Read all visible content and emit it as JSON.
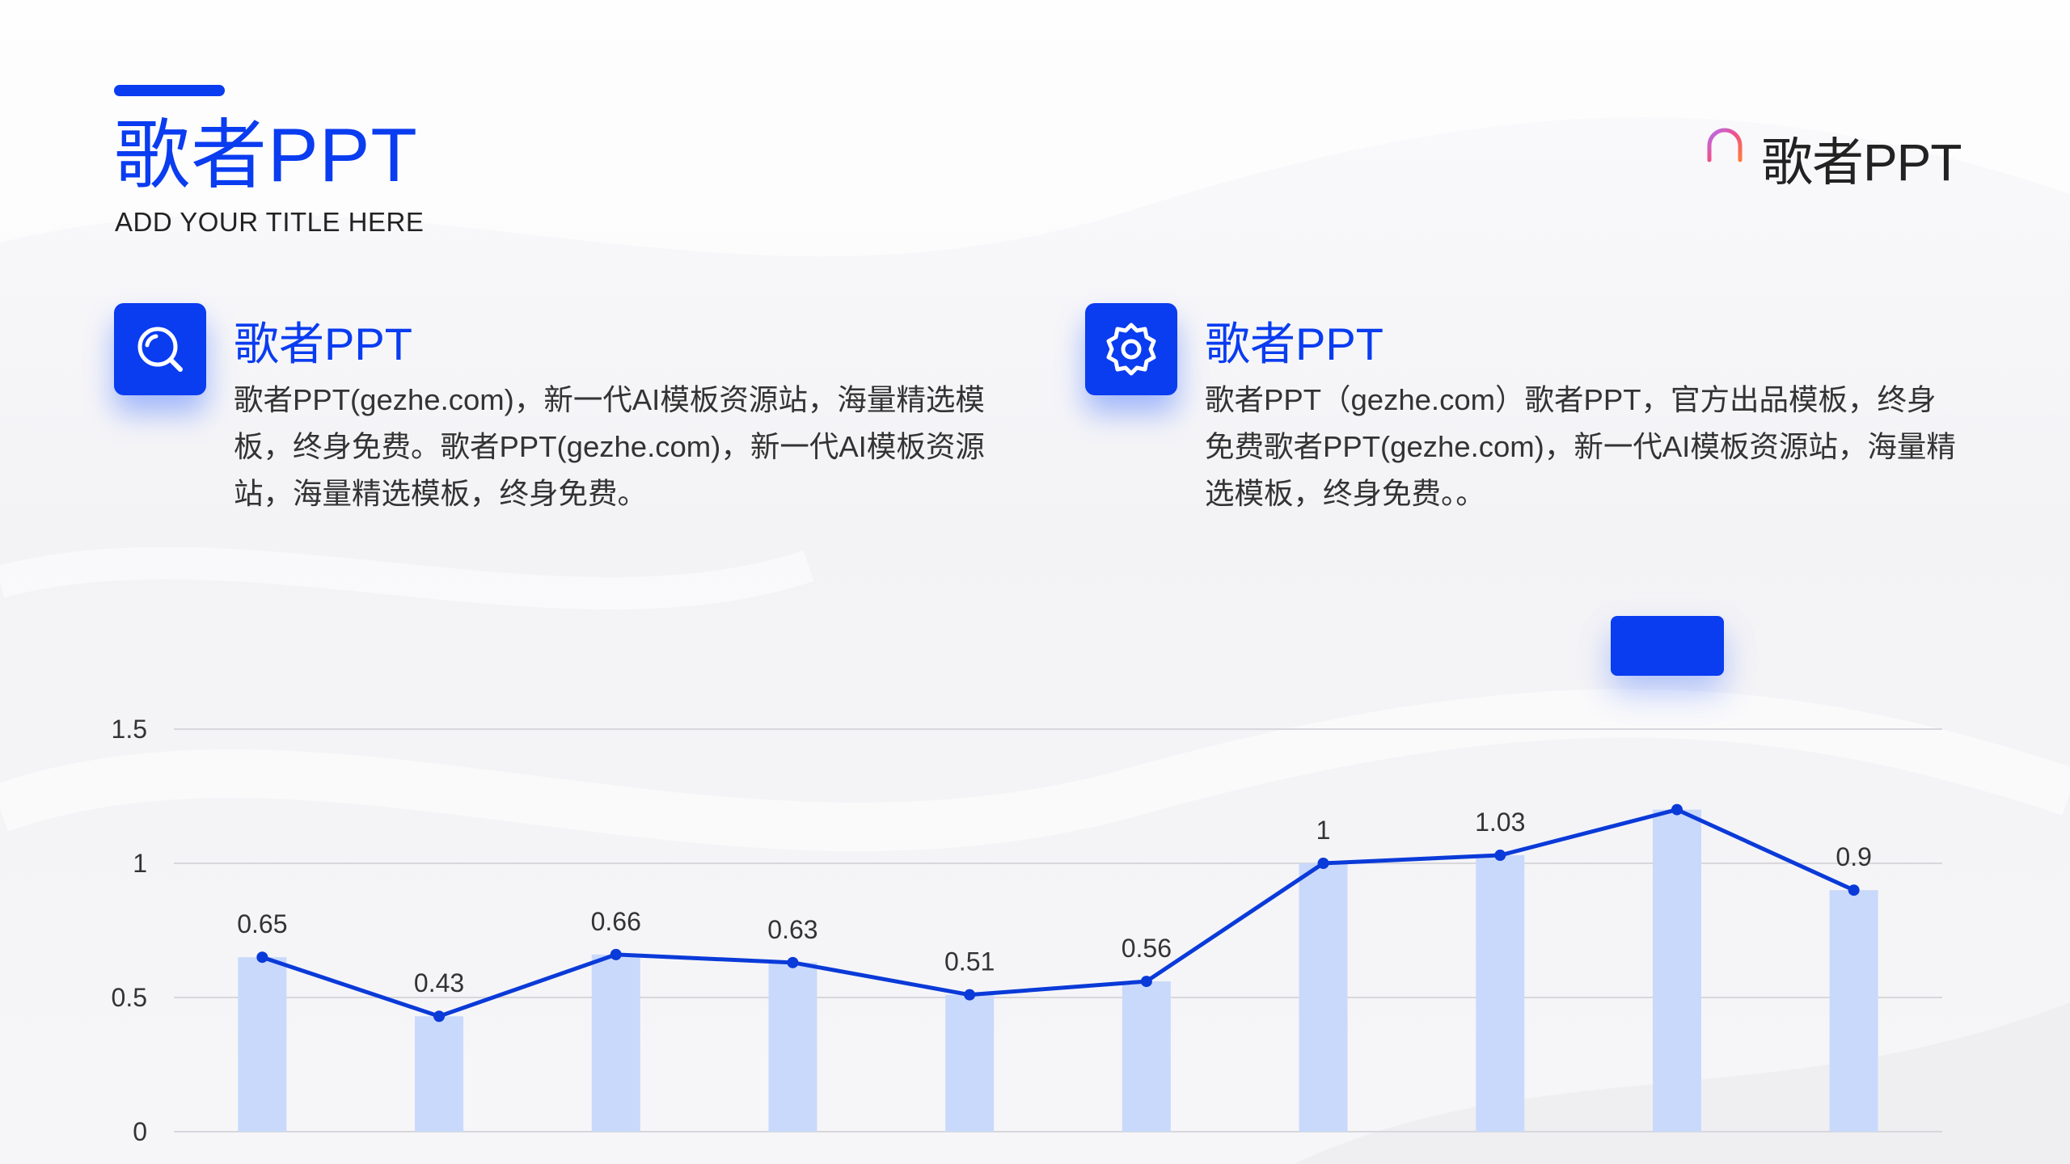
{
  "colors": {
    "accent": "#0a3cf0",
    "bar": "#c9d9fc",
    "line": "#0a3ad8",
    "gridline": "#d7d7dc",
    "tick_text": "#333333",
    "label_text": "#333333"
  },
  "header": {
    "title": "歌者PPT",
    "subtitle": "ADD YOUR TITLE HERE"
  },
  "brand": {
    "name": "歌者PPT",
    "icon": "microphone-wave-logo"
  },
  "cards": [
    {
      "icon": "search-icon",
      "title": "歌者PPT",
      "text": "歌者PPT(gezhe.com)，新一代AI模板资源站，海量精选模板，终身免费。歌者PPT(gezhe.com)，新一代AI模板资源站，海量精选模板，终身免费。"
    },
    {
      "icon": "gear-icon",
      "title": "歌者PPT",
      "text": "歌者PPT（gezhe.com）歌者PPT，官方出品模板，终身免费歌者PPT(gezhe.com)，新一代AI模板资源站，海量精选模板，终身免费。。"
    }
  ],
  "chart_data": {
    "type": "bar",
    "title": "",
    "xlabel": "",
    "ylabel": "",
    "ylim": [
      0,
      1.5
    ],
    "yticks": [
      "0",
      "0.5",
      "1",
      "1.5"
    ],
    "grid": true,
    "categories": [
      "",
      "",
      "",
      "",
      "",
      "",
      "",
      "",
      "",
      ""
    ],
    "series": [
      {
        "type": "bar",
        "values": [
          0.65,
          0.43,
          0.66,
          0.63,
          0.51,
          0.56,
          1.0,
          1.03,
          1.2,
          0.9
        ]
      },
      {
        "type": "line",
        "values": [
          0.65,
          0.43,
          0.66,
          0.63,
          0.51,
          0.56,
          1.0,
          1.03,
          1.2,
          0.9
        ]
      }
    ],
    "data_labels": [
      "0.65",
      "0.43",
      "0.66",
      "0.63",
      "0.51",
      "0.56",
      "1",
      "1.03",
      "",
      "0.9"
    ]
  }
}
